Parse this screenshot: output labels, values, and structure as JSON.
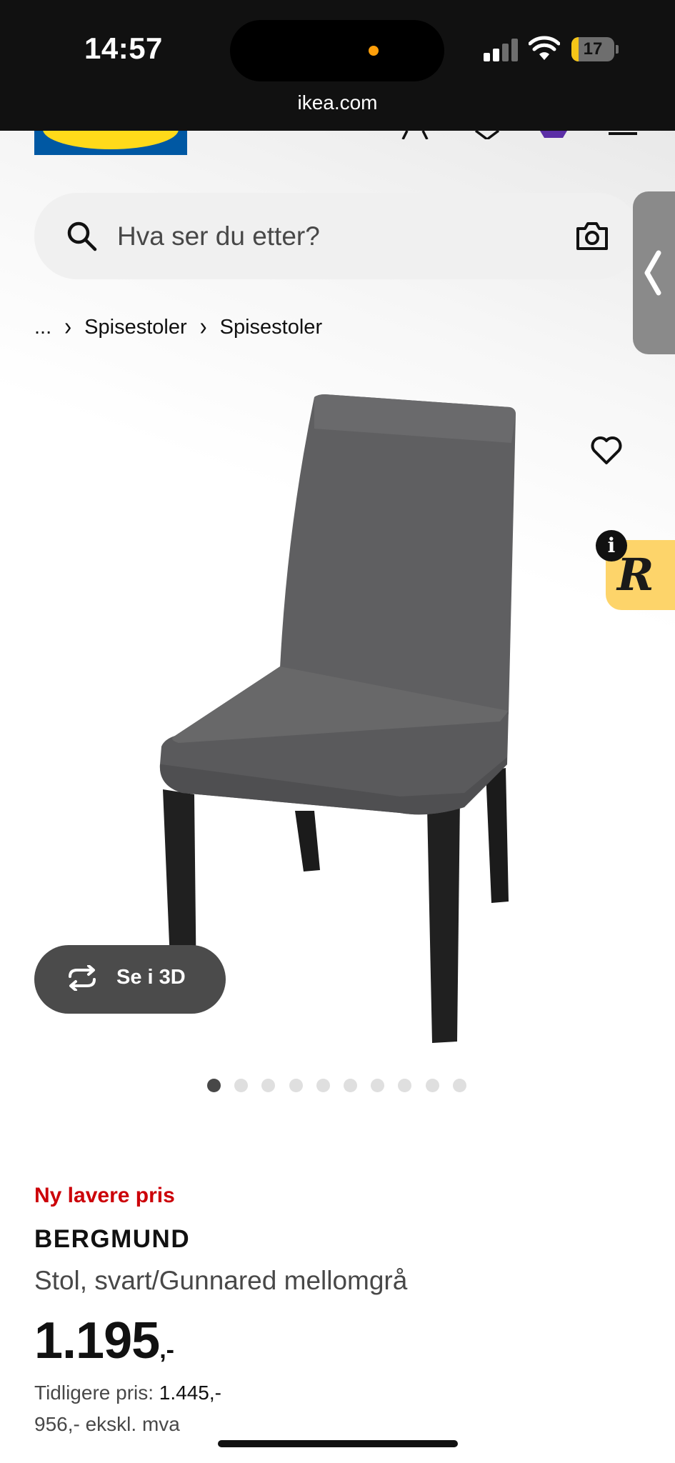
{
  "status_bar": {
    "time": "14:57",
    "battery_level": "17",
    "battery_color": "#f5c518",
    "recording_dot_color": "#ff9f0a"
  },
  "browser": {
    "url": "ikea.com"
  },
  "header": {
    "logo": "IKEA",
    "icons": [
      "account-icon",
      "heart-icon",
      "bag-icon",
      "menu-icon"
    ]
  },
  "search": {
    "placeholder": "Hva ser du etter?",
    "icons": [
      "search-icon",
      "camera-icon"
    ]
  },
  "breadcrumb": {
    "ellipsis": "...",
    "items": [
      "Spisestoler",
      "Spisestoler"
    ]
  },
  "gallery": {
    "view_3d_label": "Se i 3D",
    "total_images": 10,
    "active_index": 0
  },
  "extension": {
    "letter": "R",
    "info_letter": "i",
    "color": "#fdd46a"
  },
  "product": {
    "badge": "Ny lavere pris",
    "badge_color": "#cc0008",
    "name": "BERGMUND",
    "description": "Stol, svart/Gunnared mellomgrå",
    "price_main": "1.195",
    "price_suffix": ",-",
    "previous_price_label": "Tidligere pris:",
    "previous_price_value": "1.445,-",
    "excl_vat": "956,- ekskl. mva"
  }
}
